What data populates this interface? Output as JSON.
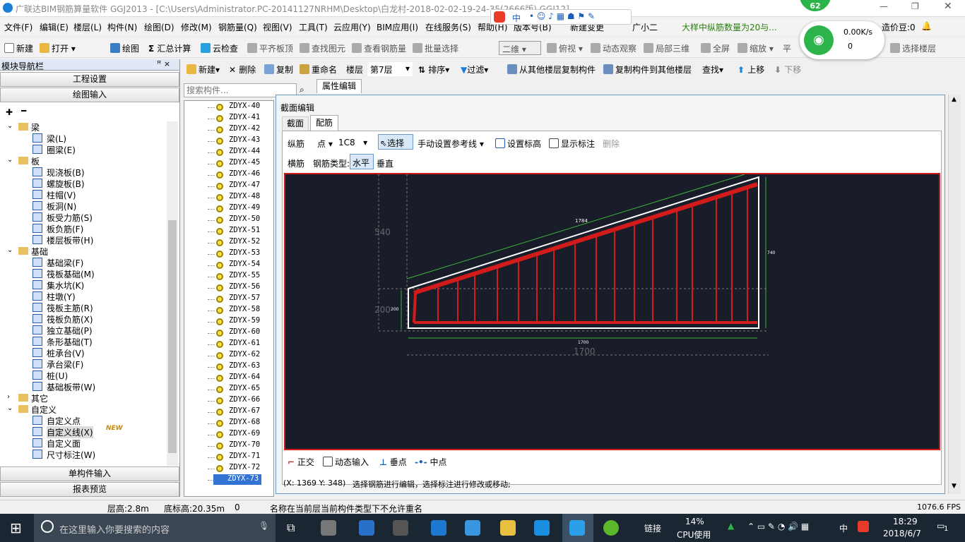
{
  "window": {
    "title": "广联达BIM钢筋算量软件 GGJ2013 - [C:\\Users\\Administrator.PC-20141127NRHM\\Desktop\\白龙村-2018-02-02-19-24-35(2666版).GGJ12]"
  },
  "menu": [
    "文件(F)",
    "编辑(E)",
    "楼层(L)",
    "构件(N)",
    "绘图(D)",
    "修改(M)",
    "钢筋量(Q)",
    "视图(V)",
    "工具(T)",
    "云应用(Y)",
    "BIM应用(I)",
    "在线服务(S)",
    "帮助(H)",
    "版本号(B)",
    "新建变更",
    "广小二"
  ],
  "notice": "大样中纵筋数量为20与...",
  "points": "造价豆:0",
  "toolbar1": [
    "新建",
    "打开",
    "绘图",
    "汇总计算",
    "云检查",
    "平齐板顶",
    "查找图元",
    "查看钢筋量",
    "批量选择",
    "二维",
    "俯视",
    "动态观察",
    "局部三维",
    "全屏",
    "缩放",
    "平",
    "选择楼层"
  ],
  "toolbar2": [
    "新建",
    "删除",
    "复制",
    "重命名",
    "楼层",
    "第7层",
    "排序",
    "过滤",
    "从其他楼层复制构件",
    "复制构件到其他楼层",
    "查找",
    "上移",
    "下移"
  ],
  "nav": {
    "title": "模块导航栏",
    "pin": "ꟸ ×",
    "project_settings": "工程设置",
    "drawing_input": "绘图输入",
    "single_input": "单构件输入",
    "report": "报表预览"
  },
  "tree": [
    {
      "label": "梁",
      "level": 0
    },
    {
      "label": "梁(L)",
      "level": 1
    },
    {
      "label": "圈梁(E)",
      "level": 1
    },
    {
      "label": "板",
      "level": 0
    },
    {
      "label": "现浇板(B)",
      "level": 1
    },
    {
      "label": "螺旋板(B)",
      "level": 1
    },
    {
      "label": "柱帽(V)",
      "level": 1
    },
    {
      "label": "板洞(N)",
      "level": 1
    },
    {
      "label": "板受力筋(S)",
      "level": 1
    },
    {
      "label": "板负筋(F)",
      "level": 1
    },
    {
      "label": "楼层板带(H)",
      "level": 1
    },
    {
      "label": "基础",
      "level": 0
    },
    {
      "label": "基础梁(F)",
      "level": 1
    },
    {
      "label": "筏板基础(M)",
      "level": 1
    },
    {
      "label": "集水坑(K)",
      "level": 1
    },
    {
      "label": "柱墩(Y)",
      "level": 1
    },
    {
      "label": "筏板主筋(R)",
      "level": 1
    },
    {
      "label": "筏板负筋(X)",
      "level": 1
    },
    {
      "label": "独立基础(P)",
      "level": 1
    },
    {
      "label": "条形基础(T)",
      "level": 1
    },
    {
      "label": "桩承台(V)",
      "level": 1
    },
    {
      "label": "承台梁(F)",
      "level": 1
    },
    {
      "label": "桩(U)",
      "level": 1
    },
    {
      "label": "基础板带(W)",
      "level": 1
    },
    {
      "label": "其它",
      "level": 0
    },
    {
      "label": "自定义",
      "level": 0
    },
    {
      "label": "自定义点",
      "level": 1
    },
    {
      "label": "自定义线(X)",
      "level": 1
    },
    {
      "label": "自定义面",
      "level": 1
    },
    {
      "label": "尺寸标注(W)",
      "level": 1
    }
  ],
  "new_badge": "NEW",
  "search_placeholder": "搜索构件...",
  "components": [
    "ZDYX-40",
    "ZDYX-41",
    "ZDYX-42",
    "ZDYX-43",
    "ZDYX-44",
    "ZDYX-45",
    "ZDYX-46",
    "ZDYX-47",
    "ZDYX-48",
    "ZDYX-49",
    "ZDYX-50",
    "ZDYX-51",
    "ZDYX-52",
    "ZDYX-53",
    "ZDYX-54",
    "ZDYX-55",
    "ZDYX-56",
    "ZDYX-57",
    "ZDYX-58",
    "ZDYX-59",
    "ZDYX-60",
    "ZDYX-61",
    "ZDYX-62",
    "ZDYX-63",
    "ZDYX-64",
    "ZDYX-65",
    "ZDYX-66",
    "ZDYX-67",
    "ZDYX-68",
    "ZDYX-69",
    "ZDYX-70",
    "ZDYX-71",
    "ZDYX-72",
    "ZDYX-73"
  ],
  "selected_component": "ZDYX-73",
  "prop_tab": "属性编辑",
  "dialog": {
    "title": "截面编辑",
    "tabs": [
      "截面",
      "配筋"
    ],
    "row1": {
      "longitudinal": "纵筋",
      "point": "点",
      "spec": "1C8",
      "select": "选择",
      "manual_ref": "手动设置参考线",
      "set_elev": "设置标高",
      "show_dim": "显示标注",
      "delete": "删除"
    },
    "row2": {
      "transverse": "横筋",
      "type_label": "钢筋类型:",
      "horizontal": "水平",
      "vertical": "垂直"
    },
    "dims": {
      "top": "1784",
      "right": "740",
      "left_big": "540",
      "left_small": "200",
      "left_tiny": "200",
      "bottom_small": "1700",
      "bottom_big": "1700"
    },
    "bottom_tools": [
      "正交",
      "动态输入",
      "垂点",
      "中点"
    ],
    "coord": "(X: 1369 Y: 348)",
    "hint": "选择钢筋进行编辑，选择标注进行修改或移动;"
  },
  "status": {
    "floor_h": "层高:2.8m",
    "base_h": "底标高:20.35m",
    "zero": "0",
    "msg": "名称在当前层当前构件类型下不允许重名",
    "fps": "1076.6 FPS"
  },
  "network": {
    "badge": "62",
    "speed": "0.00K/s",
    "count": "0"
  },
  "taskbar": {
    "search": "在这里输入你要搜索的内容",
    "link": "链接",
    "cpu_pct": "14%",
    "cpu_label": "CPU使用",
    "ime": "中",
    "time": "18:29",
    "date": "2018/6/7",
    "notif": "1"
  },
  "colors": {
    "rebar": "#d21b1b",
    "canvas_bg": "#191c29",
    "dim_green": "#3cb83c",
    "accent": "#1a7fd4"
  }
}
